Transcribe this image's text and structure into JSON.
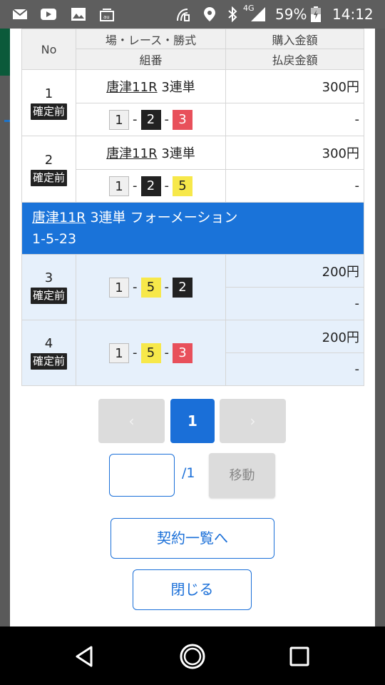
{
  "status_bar": {
    "network": "4G",
    "battery": "59%",
    "time": "14:12",
    "icons": [
      "mail-icon",
      "youtube-icon",
      "image-icon",
      "au-wallet-icon",
      "nfc-icon",
      "location-icon",
      "bluetooth-icon",
      "signal-icon",
      "battery-icon"
    ]
  },
  "table": {
    "header": {
      "no": "No",
      "venue_race_type": "場・レース・勝式",
      "purchase_amount": "購入金額",
      "combination": "組番",
      "payout_amount": "払戻金額"
    },
    "rows": [
      {
        "no": "1",
        "badge": "確定前",
        "race_link": "唐津11R",
        "bet_type": "3連単",
        "combo": [
          "1",
          "2",
          "3"
        ],
        "purchase": "300円",
        "payout": "-"
      },
      {
        "no": "2",
        "badge": "確定前",
        "race_link": "唐津11R",
        "bet_type": "3連単",
        "combo": [
          "1",
          "2",
          "5"
        ],
        "purchase": "300円",
        "payout": "-"
      }
    ],
    "formation": {
      "race_link": "唐津11R",
      "title": "3連単 フォーメーション",
      "pattern": "1-5-23"
    },
    "formation_rows": [
      {
        "no": "3",
        "badge": "確定前",
        "combo": [
          "1",
          "5",
          "2"
        ],
        "purchase": "200円",
        "payout": "-"
      },
      {
        "no": "4",
        "badge": "確定前",
        "combo": [
          "1",
          "5",
          "3"
        ],
        "purchase": "200円",
        "payout": "-"
      }
    ],
    "sep": "-"
  },
  "pager": {
    "prev": "‹",
    "current": "1",
    "next": "›",
    "input_value": "",
    "total": "/1",
    "move": "移動"
  },
  "buttons": {
    "contract_list": "契約一覧へ",
    "close": "閉じる"
  },
  "colors": {
    "accent": "#1a6fd8",
    "boat1": "#f0f0f0",
    "boat2": "#222222",
    "boat3": "#e8505b",
    "boat5": "#f7e84a"
  }
}
